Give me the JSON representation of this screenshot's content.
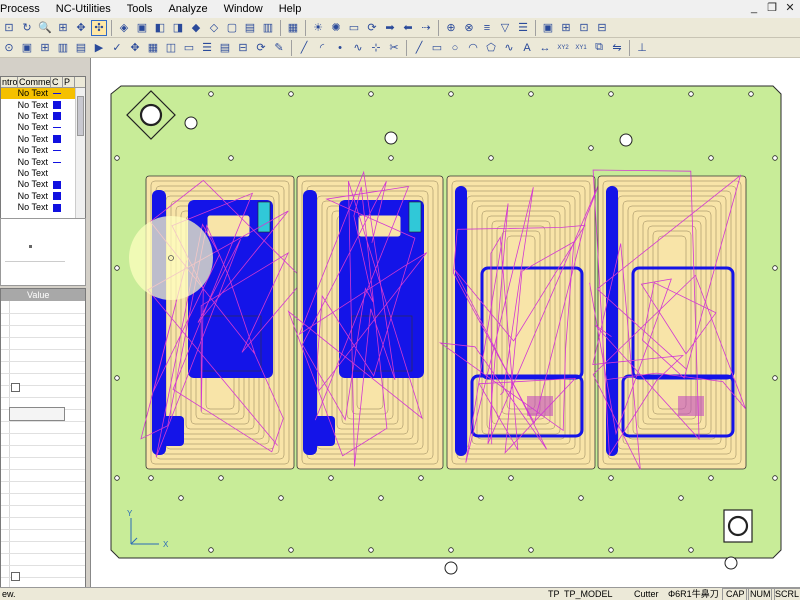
{
  "menu": {
    "items": [
      "Process",
      "NC-Utilities",
      "Tools",
      "Analyze",
      "Window",
      "Help"
    ]
  },
  "window_controls": {
    "minimize": "_",
    "restore": "❐",
    "close": "✕"
  },
  "toolbar1": {
    "icons": [
      "zoom-window-icon",
      "rotate-icon",
      "zoom-icon",
      "fit-icon",
      "pan-icon",
      "dynamic-view-icon",
      "sep",
      "view-iso-icon",
      "view-top-icon",
      "view-front-icon",
      "view-right-icon",
      "shade-icon",
      "wireframe-icon",
      "hidden-icon",
      "model-icon",
      "display-icon",
      "sep",
      "color-icon",
      "sep",
      "bulb-icon",
      "bulb-on-icon",
      "doc-icon",
      "refresh-icon",
      "forward-icon",
      "back-icon",
      "arrow-icon",
      "sep",
      "tree-icon",
      "measure-icon",
      "layer-icon",
      "filter-icon",
      "stack-icon",
      "sep",
      "select-icon",
      "grid-icon",
      "snap-icon",
      "ortho-icon"
    ],
    "active_index": 5
  },
  "toolbar2": {
    "icons": [
      "drill-icon",
      "feature-icon",
      "wcs-icon",
      "tool-icon",
      "path-icon",
      "sim-icon",
      "check-icon",
      "move-icon",
      "stock-icon",
      "param-icon",
      "plate-icon",
      "list-icon",
      "library-icon",
      "fixture-icon",
      "cycle-icon",
      "engrave-icon",
      "sep",
      "line-icon",
      "arc-icon",
      "point-icon",
      "spline-icon",
      "node-icon",
      "trim-icon",
      "sep",
      "draw-line-icon",
      "draw-rect-icon",
      "draw-circle-icon",
      "draw-arc-icon",
      "draw-poly-icon",
      "draw-curve-icon",
      "text-icon",
      "dimension-icon",
      "xy2-icon",
      "xy1-icon",
      "offset-icon",
      "mirror-icon",
      "sep",
      "axis-icon"
    ],
    "xy2_label": "XY2",
    "xy1_label": "XY1"
  },
  "operations_panel": {
    "columns": [
      "ntrol",
      "Comment",
      "C",
      "P"
    ],
    "rows": [
      {
        "comment": "No Text",
        "mark": "line",
        "selected": true
      },
      {
        "comment": "No Text",
        "mark": "square",
        "selected": false
      },
      {
        "comment": "No Text",
        "mark": "square",
        "selected": false
      },
      {
        "comment": "No Text",
        "mark": "line",
        "selected": false
      },
      {
        "comment": "No Text",
        "mark": "square",
        "selected": false
      },
      {
        "comment": "No Text",
        "mark": "line",
        "selected": false
      },
      {
        "comment": "No Text",
        "mark": "line",
        "selected": false
      },
      {
        "comment": "No Text",
        "mark": "none",
        "selected": false
      },
      {
        "comment": "No Text",
        "mark": "square",
        "selected": false
      },
      {
        "comment": "No Text",
        "mark": "square",
        "selected": false
      },
      {
        "comment": "No Text",
        "mark": "square",
        "selected": false
      }
    ],
    "selected_color": "#f5c000",
    "mark_color": "#1010e0"
  },
  "properties_panel": {
    "value_header": "Value"
  },
  "viewport": {
    "plate_color": "#c8ec98",
    "pocket_color": "#f8e4a8",
    "toolpath_blue": "#1414e8",
    "toolpath_magenta": "#d238d2"
  },
  "status_bar": {
    "left_text": "ew.",
    "tp_label": "TP",
    "tp_model": "TP_MODEL",
    "cutter_label": "Cutter",
    "cutter_value": "Φ6R1牛鼻刀",
    "cap": "CAP",
    "num": "NUM",
    "scrl": "SCRL"
  }
}
